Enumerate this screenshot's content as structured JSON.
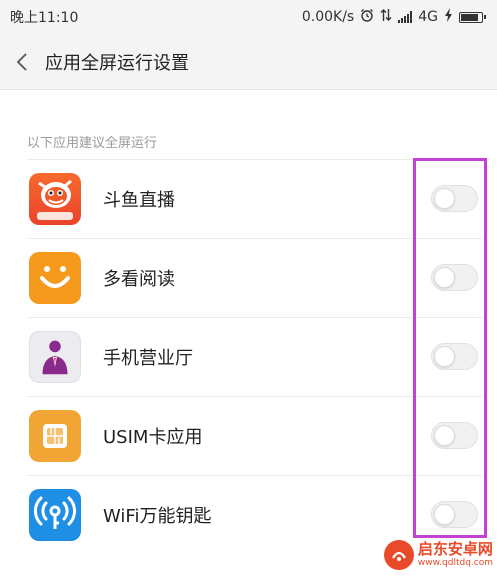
{
  "status_bar": {
    "time": "晚上11:10",
    "net_speed": "0.00K/s",
    "network_type": "4G",
    "icons": [
      "alarm-icon",
      "data-arrows-icon",
      "signal-icon",
      "charging-icon",
      "battery-icon"
    ],
    "battery_level": 0.9
  },
  "title_bar": {
    "back_icon": "chevron-left-icon",
    "title": "应用全屏运行设置"
  },
  "section": {
    "header": "以下应用建议全屏运行"
  },
  "apps": [
    {
      "name": "斗鱼直播",
      "icon": "douyu-app-icon",
      "enabled": false,
      "color": "#f2592a"
    },
    {
      "name": "多看阅读",
      "icon": "duokan-app-icon",
      "enabled": false,
      "color": "#f59a1d"
    },
    {
      "name": "手机营业厅",
      "icon": "mobile-hall-app-icon",
      "enabled": false,
      "color": "#e9e9ee"
    },
    {
      "name": "USIM卡应用",
      "icon": "usim-app-icon",
      "enabled": false,
      "color": "#f0a535"
    },
    {
      "name": "WiFi万能钥匙",
      "icon": "wifi-key-app-icon",
      "enabled": false,
      "color": "#1f8fe6"
    }
  ],
  "watermark": {
    "title": "启东安卓网",
    "url": "www.qdltdq.com"
  },
  "colors": {
    "highlight_border": "#c640d6",
    "toggle_off": "#f1f1f1"
  }
}
